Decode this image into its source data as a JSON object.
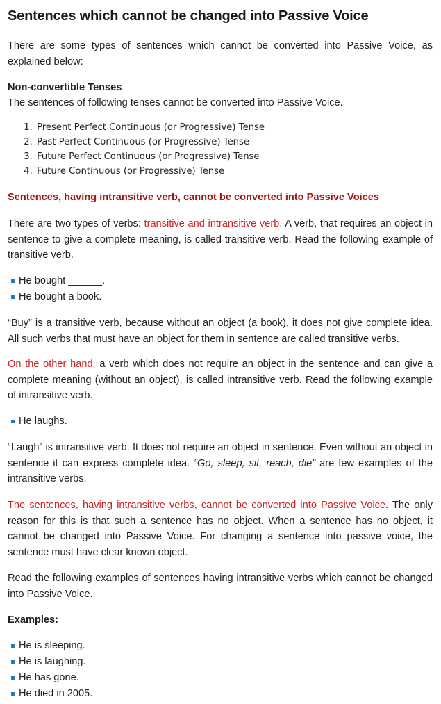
{
  "title": "Sentences which cannot be changed into Passive Voice",
  "intro": "There are some types of sentences which cannot be converted into Passive Voice, as explained below:",
  "non_convertible": {
    "heading": "Non-convertible Tenses",
    "text": "The sentences of following tenses cannot be converted into Passive Voice.",
    "items": [
      "Present Perfect Continuous (or Progressive) Tense",
      "Past Perfect Continuous (or Progressive) Tense",
      "Future Perfect Continuous (or Progressive) Tense",
      "Future Continuous (or Progressive) Tense"
    ]
  },
  "intransitive": {
    "heading": "Sentences, having intransitive verb, cannot be converted into Passive Voices",
    "p1_before": "There are two types of verbs: ",
    "p1_highlight": "transitive and intransitive verb",
    "p1_after": ". A verb, that requires an object in sentence to give a complete meaning, is called transitive verb. Read the following example of transitive verb.",
    "transitive_examples": [
      "He bought ______.",
      "He bought a book."
    ],
    "p2": "“Buy” is a transitive verb, because without an object (a book), it does not give complete idea. All such verbs that must have an object for them in sentence are called transitive verbs.",
    "p3_highlight": "On the other hand,",
    "p3_after": " a verb which does not require an object in the sentence and can give a complete meaning (without an object), is called intransitive verb. Read the following example of intransitive verb.",
    "intransitive_examples": [
      "He laughs."
    ],
    "p4_before": "“Laugh” is intransitive verb. It does not require an object in sentence. Even without an object in sentence it can express complete idea. ",
    "p4_italic": "“Go, sleep, sit, reach, die”",
    "p4_after": " are few examples of the intransitive verbs.",
    "p5_highlight": "The sentences, having intransitive verbs, cannot be converted into Passive Voice",
    "p5_after": ". The only reason for this is that such a sentence has no object. When a sentence has no object, it cannot be changed into Passive Voice. For changing a sentence into passive voice, the sentence must have clear known object.",
    "p6": "Read the following examples of sentences having intransitive verbs which cannot be changed into Passive Voice."
  },
  "examples": {
    "heading": "Examples:",
    "items": [
      "He is sleeping.",
      "He is laughing.",
      "He has gone.",
      "He died in 2005."
    ]
  },
  "colors": {
    "highlight_red": "#cc2222",
    "heading_red": "#a31515",
    "bullet_blue": "#2a7ab8"
  }
}
